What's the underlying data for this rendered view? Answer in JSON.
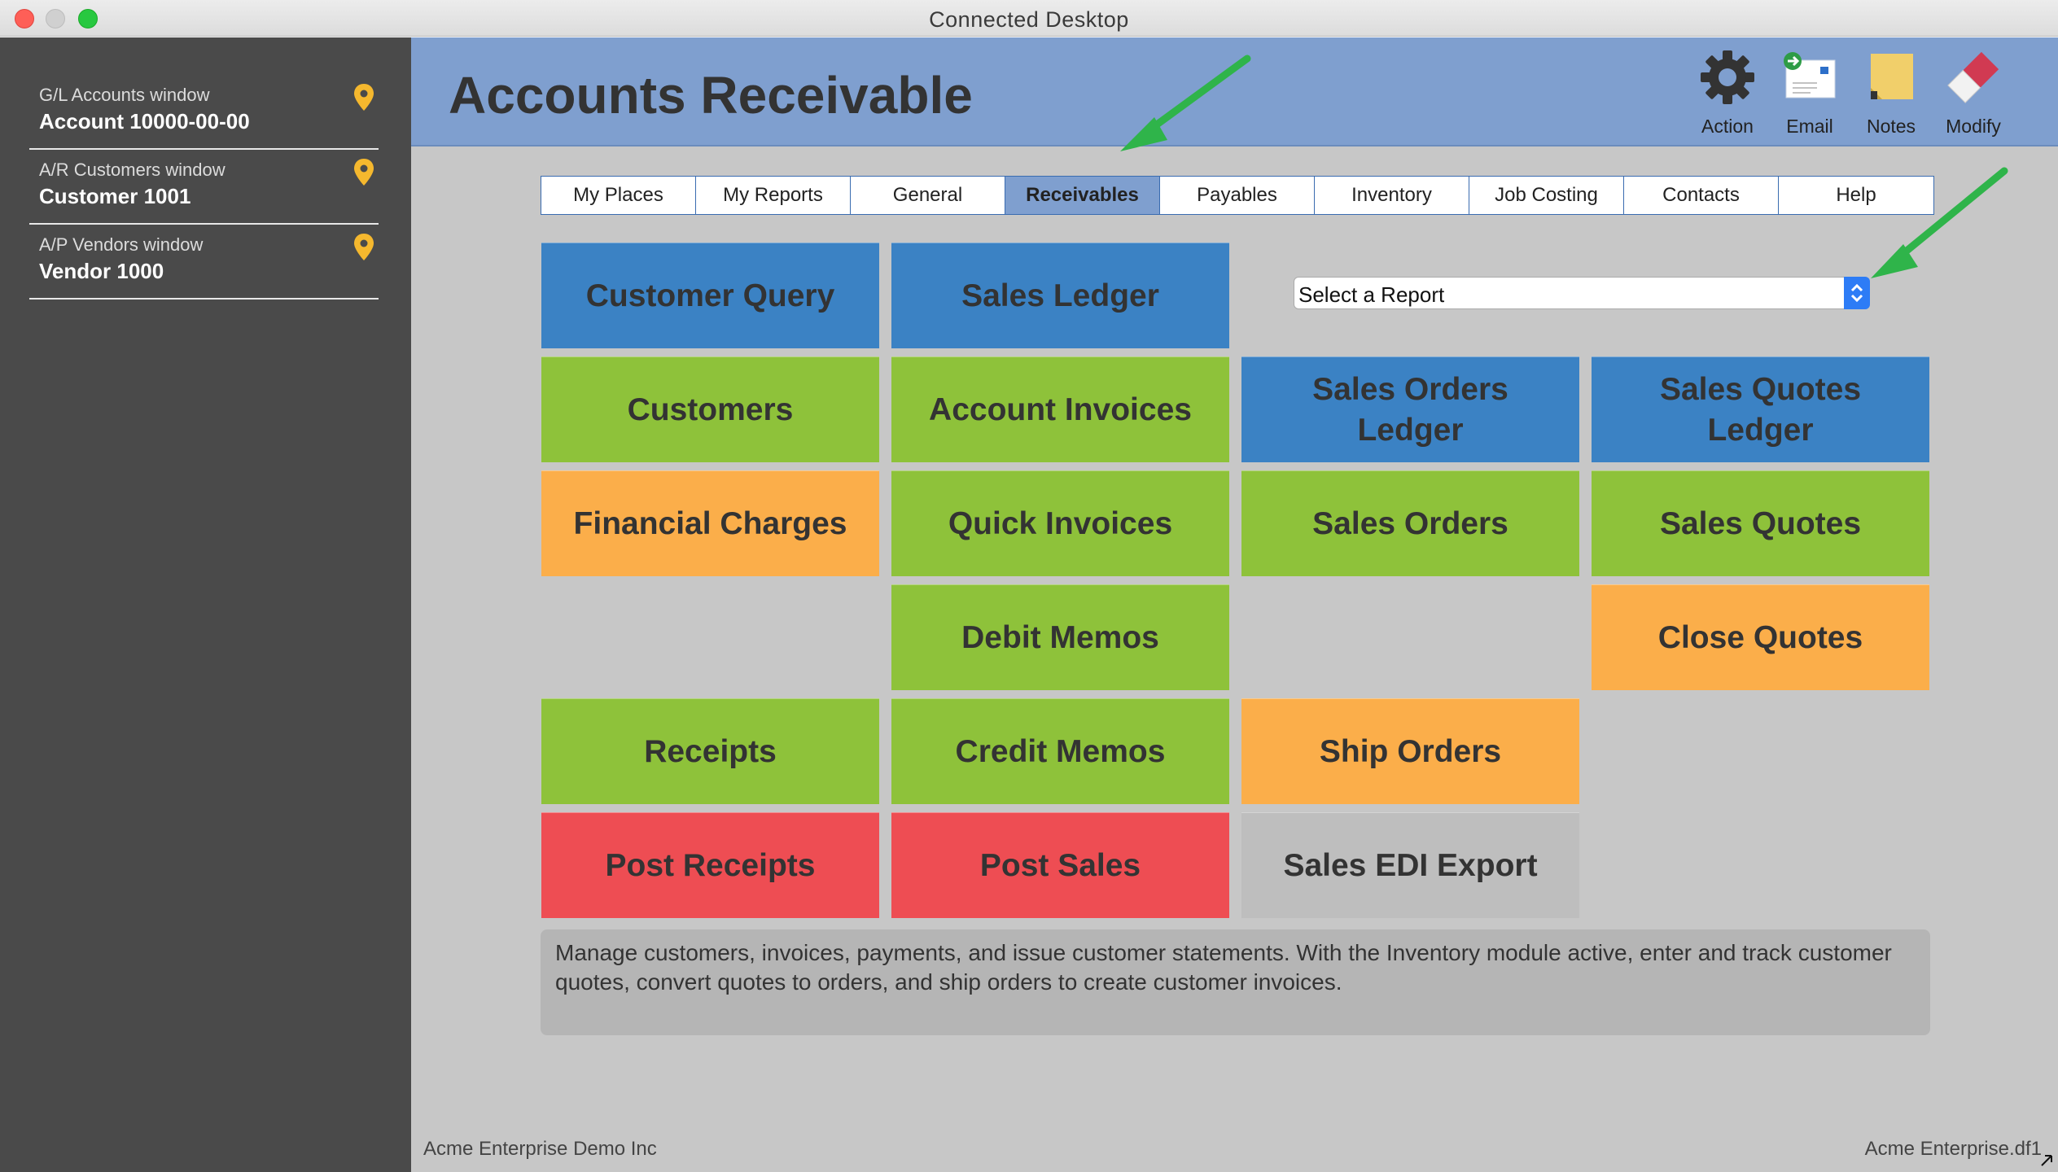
{
  "window": {
    "title": "Connected Desktop"
  },
  "sidebar": {
    "places": [
      {
        "label": "G/L Accounts window",
        "value": "Account 10000-00-00"
      },
      {
        "label": "A/R Customers window",
        "value": "Customer 1001"
      },
      {
        "label": "A/P Vendors window",
        "value": "Vendor 1000"
      }
    ]
  },
  "header": {
    "title": "Accounts Receivable",
    "tools": [
      {
        "label": "Action",
        "icon": "gear-icon"
      },
      {
        "label": "Email",
        "icon": "email-icon"
      },
      {
        "label": "Notes",
        "icon": "note-icon"
      },
      {
        "label": "Modify",
        "icon": "eraser-icon"
      }
    ]
  },
  "tabs": [
    {
      "label": "My Places"
    },
    {
      "label": "My Reports"
    },
    {
      "label": "General"
    },
    {
      "label": "Receivables",
      "active": true
    },
    {
      "label": "Payables"
    },
    {
      "label": "Inventory"
    },
    {
      "label": "Job Costing"
    },
    {
      "label": "Contacts"
    },
    {
      "label": "Help"
    }
  ],
  "report_select": {
    "value": "Select a Report"
  },
  "tiles": {
    "customer_query": "Customer Query",
    "sales_ledger": "Sales Ledger",
    "customers": "Customers",
    "account_invoices": "Account Invoices",
    "sales_orders_ledger": "Sales Orders Ledger",
    "sales_quotes_ledger": "Sales Quotes Ledger",
    "financial_charges": "Financial Charges",
    "quick_invoices": "Quick Invoices",
    "sales_orders": "Sales Orders",
    "sales_quotes": "Sales Quotes",
    "debit_memos": "Debit Memos",
    "close_quotes": "Close Quotes",
    "receipts": "Receipts",
    "credit_memos": "Credit Memos",
    "ship_orders": "Ship Orders",
    "post_receipts": "Post Receipts",
    "post_sales": "Post Sales",
    "sales_edi_export": "Sales EDI Export"
  },
  "colors": {
    "blue_tile": "#3b82c4",
    "green_tile": "#8ec23a",
    "orange_tile": "#fbae4a",
    "red_tile": "#ee4d53",
    "gray_tile": "#bebebe",
    "header": "#7f9fcf",
    "sidebar": "#4a4a4a",
    "annotation_arrow": "#2fb44a"
  },
  "description": "Manage customers, invoices, payments, and issue customer statements. With the Inventory module active, enter and track customer quotes, convert quotes to orders, and ship orders to create customer invoices.",
  "footer": {
    "company": "Acme Enterprise Demo Inc",
    "file": "Acme Enterprise.df1"
  }
}
